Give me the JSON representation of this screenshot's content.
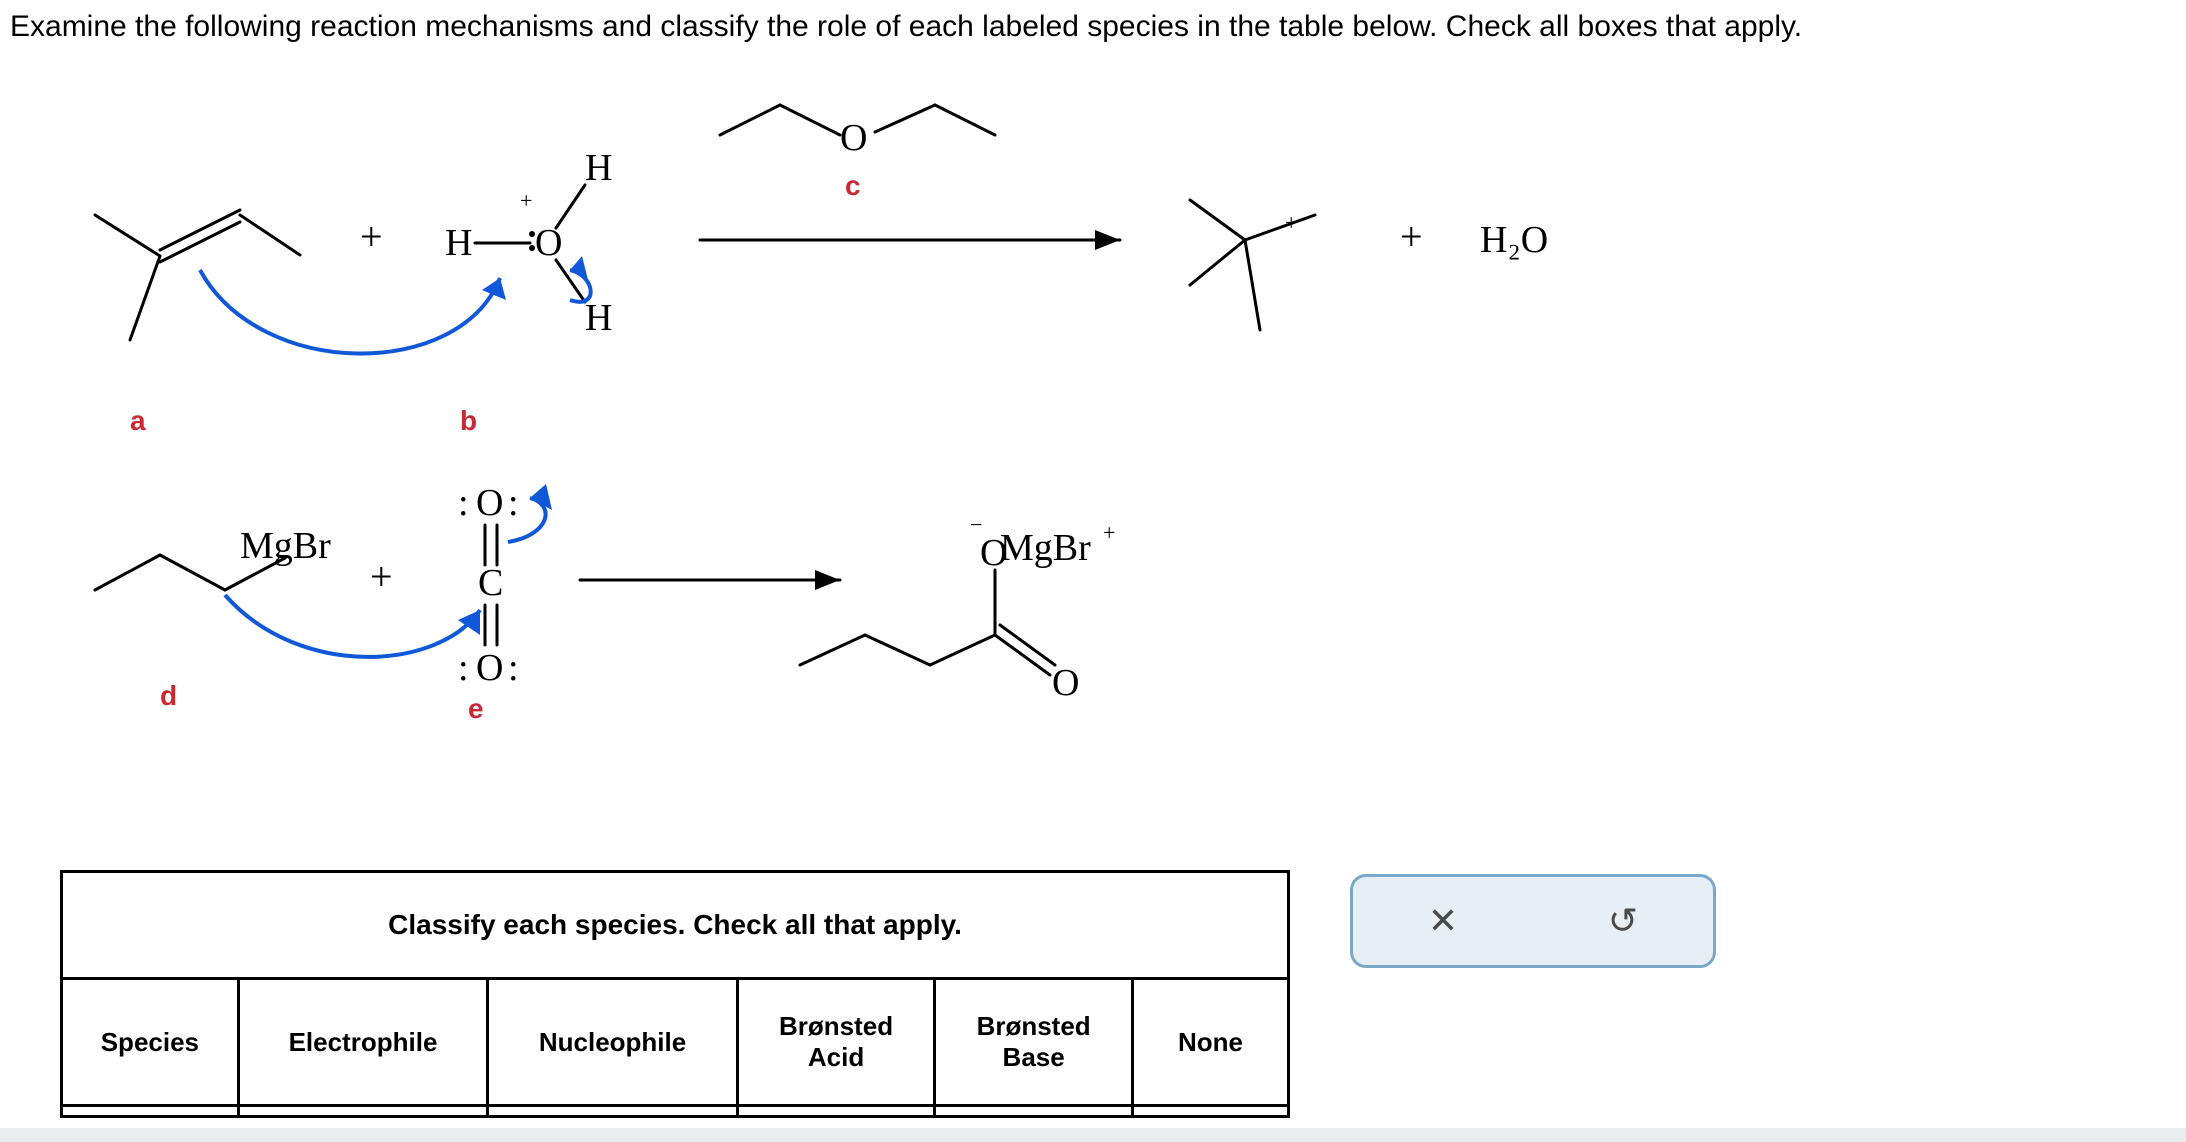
{
  "question": "Examine the following reaction mechanisms and classify the role of each labeled species in the table below. Check all boxes that apply.",
  "labels": {
    "a": "a",
    "b": "b",
    "c": "c",
    "d": "d",
    "e": "e"
  },
  "atoms": {
    "H_top": "H",
    "H_left": "H",
    "H_bot": "H",
    "O": "O",
    "O_ether": "O",
    "O_top": "O",
    "O_bot": "O",
    "C": "C",
    "H2O": "H₂O",
    "MgBr": "MgBr",
    "MgBr_prod": "MgBr",
    "minus": "−",
    "plus_charge": "+"
  },
  "symbols": {
    "plus1": "+",
    "plus2": "+",
    "plus3": "+"
  },
  "table": {
    "caption": "Classify each species. Check all that apply.",
    "headers": {
      "species": "Species",
      "electrophile": "Electrophile",
      "nucleophile": "Nucleophile",
      "acid": "Brønsted Acid",
      "base": "Brønsted Base",
      "none": "None"
    }
  },
  "toolbar": {
    "close": "✕",
    "reset": "↺"
  }
}
